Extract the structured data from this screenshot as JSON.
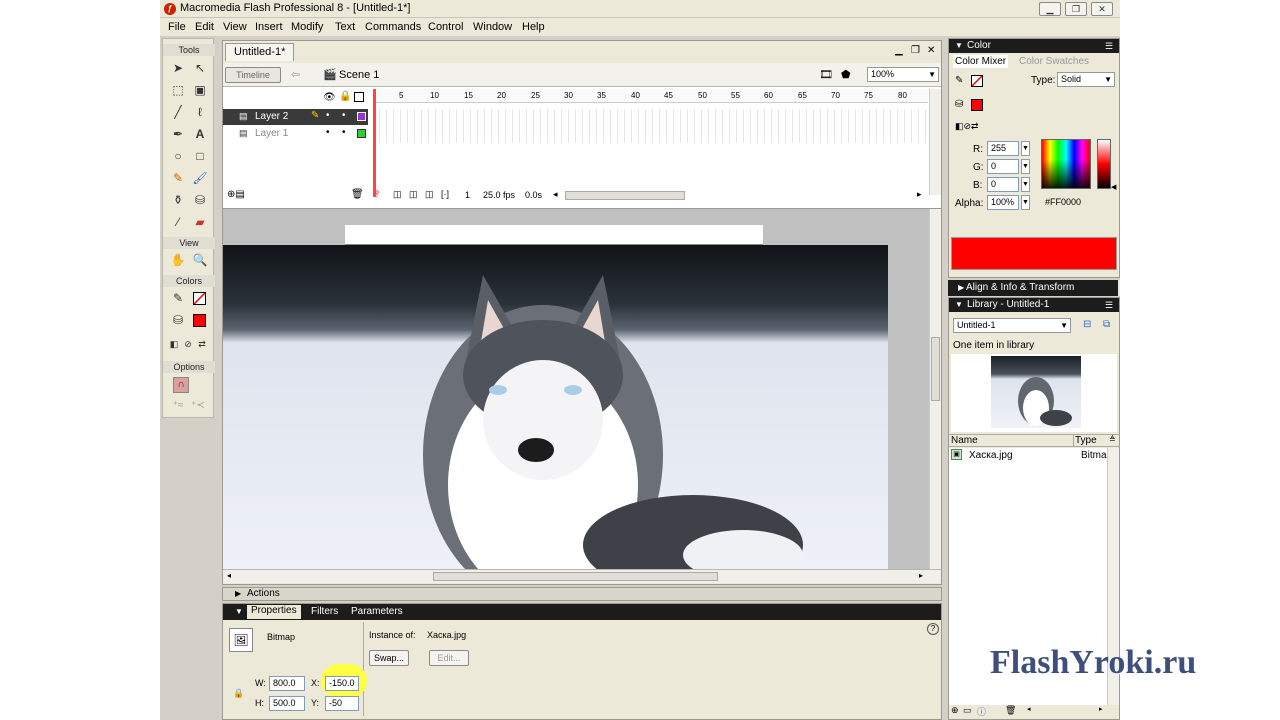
{
  "window": {
    "title": "Macromedia Flash Professional 8 - [Untitled-1*]",
    "app_icon": "flash-icon"
  },
  "menu": [
    "File",
    "Edit",
    "View",
    "Insert",
    "Modify",
    "Text",
    "Commands",
    "Control",
    "Window",
    "Help"
  ],
  "tools": {
    "title": "Tools",
    "view_label": "View",
    "colors_label": "Colors",
    "options_label": "Options"
  },
  "document": {
    "tab": "Untitled-1*",
    "timeline_button": "Timeline",
    "scene": "Scene 1",
    "zoom": "100%",
    "frame_numbers": [
      "5",
      "10",
      "15",
      "20",
      "25",
      "30",
      "35",
      "40",
      "45",
      "50",
      "55",
      "60",
      "65",
      "70",
      "75",
      "80"
    ],
    "layers": [
      {
        "name": "Layer 2",
        "selected": true,
        "color": "#9933cc"
      },
      {
        "name": "Layer 1",
        "selected": false,
        "color": "#33cc33"
      }
    ],
    "current_frame": "1",
    "fps": "25.0 fps",
    "time": "0.0s"
  },
  "actions": {
    "label": "Actions"
  },
  "properties": {
    "tabs": [
      "Properties",
      "Filters",
      "Parameters"
    ],
    "type": "Bitmap",
    "instance_label": "Instance of:",
    "instance_value": "Хаска.jpg",
    "swap_label": "Swap...",
    "edit_label": "Edit...",
    "w_label": "W:",
    "w_value": "800.0",
    "h_label": "H:",
    "h_value": "500.0",
    "x_label": "X:",
    "x_value": "-150.0",
    "y_label": "Y:",
    "y_value": "-50"
  },
  "color_panel": {
    "header": "Color",
    "tab_mixer": "Color Mixer",
    "tab_swatches": "Color Swatches",
    "type_label": "Type:",
    "type_value": "Solid",
    "r_label": "R:",
    "r_value": "255",
    "g_label": "G:",
    "g_value": "0",
    "b_label": "B:",
    "b_value": "0",
    "alpha_label": "Alpha:",
    "alpha_value": "100%",
    "hex_value": "#FF0000",
    "swatch_color": "#ff0000"
  },
  "align_panel": {
    "header": "Align & Info & Transform"
  },
  "library": {
    "header": "Library - Untitled-1",
    "dropdown": "Untitled-1",
    "count_text": "One item in library",
    "col_name": "Name",
    "col_type": "Type",
    "items": [
      {
        "name": "Хаска.jpg",
        "type": "Bitma"
      }
    ]
  },
  "watermark": "FlashYroki.ru"
}
